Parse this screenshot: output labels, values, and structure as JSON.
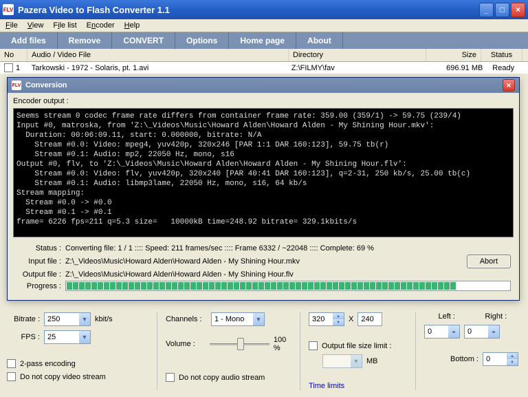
{
  "window": {
    "title": "Pazera Video to Flash Converter 1.1"
  },
  "menu": {
    "file": "File",
    "view": "View",
    "filelist": "File list",
    "encoder": "Encoder",
    "help": "Help"
  },
  "toolbar": {
    "add": "Add files",
    "remove": "Remove",
    "convert": "CONVERT",
    "options": "Options",
    "home": "Home page",
    "about": "About"
  },
  "list": {
    "headers": {
      "no": "No",
      "file": "Audio / Video File",
      "dir": "Directory",
      "size": "Size",
      "status": "Status"
    },
    "row": {
      "no": "1",
      "file": "Tarkowski - 1972 - Solaris, pt. 1.avi",
      "dir": "Z:\\FILMY\\fav",
      "size": "696.91 MB",
      "status": "Ready"
    }
  },
  "conversion": {
    "title": "Conversion",
    "encoder_output_label": "Encoder output :",
    "console": "Seems stream 0 codec frame rate differs from container frame rate: 359.00 (359/1) -> 59.75 (239/4)\nInput #0, matroska, from 'Z:\\_Videos\\Music\\Howard Alden\\Howard Alden - My Shining Hour.mkv':\n  Duration: 00:06:09.11, start: 0.000000, bitrate: N/A\n    Stream #0.0: Video: mpeg4, yuv420p, 320x246 [PAR 1:1 DAR 160:123], 59.75 tb(r)\n    Stream #0.1: Audio: mp2, 22050 Hz, mono, s16\nOutput #0, flv, to 'Z:\\_Videos\\Music\\Howard Alden\\Howard Alden - My Shining Hour.flv':\n    Stream #0.0: Video: flv, yuv420p, 320x240 [PAR 40:41 DAR 160:123], q=2-31, 250 kb/s, 25.00 tb(c)\n    Stream #0.1: Audio: libmp3lame, 22050 Hz, mono, s16, 64 kb/s\nStream mapping:\n  Stream #0.0 -> #0.0\n  Stream #0.1 -> #0.1\nframe= 6226 fps=211 q=5.3 size=   10000kB time=248.92 bitrate= 329.1kbits/s",
    "status_label": "Status :",
    "status_value": "Converting file: 1 / 1  ::::  Speed: 211 frames/sec  ::::  Frame 6332 / ~22048  ::::  Complete: 69 %",
    "input_label": "Input file :",
    "input_value": "Z:\\_Videos\\Music\\Howard Alden\\Howard Alden - My Shining Hour.mkv",
    "output_label": "Output file :",
    "output_value": "Z:\\_Videos\\Music\\Howard Alden\\Howard Alden - My Shining Hour.flv",
    "progress_label": "Progress :",
    "abort": "Abort"
  },
  "bottom": {
    "bitrate_label": "Bitrate :",
    "bitrate_value": "250",
    "bitrate_unit": "kbit/s",
    "fps_label": "FPS :",
    "fps_value": "25",
    "twopass": "2-pass encoding",
    "no_video": "Do not copy video stream",
    "channels_label": "Channels :",
    "channels_value": "1 - Mono",
    "volume_label": "Volume :",
    "volume_value": "100 %",
    "no_audio": "Do not copy audio stream",
    "width": "320",
    "x": "X",
    "height": "240",
    "filesize_limit": "Output file size limit :",
    "mb": "MB",
    "time_limits": "Time limits",
    "left_label": "Left :",
    "left_value": "0",
    "right_label": "Right :",
    "right_value": "0",
    "bottom_label": "Bottom :",
    "bottom_value": "0"
  }
}
